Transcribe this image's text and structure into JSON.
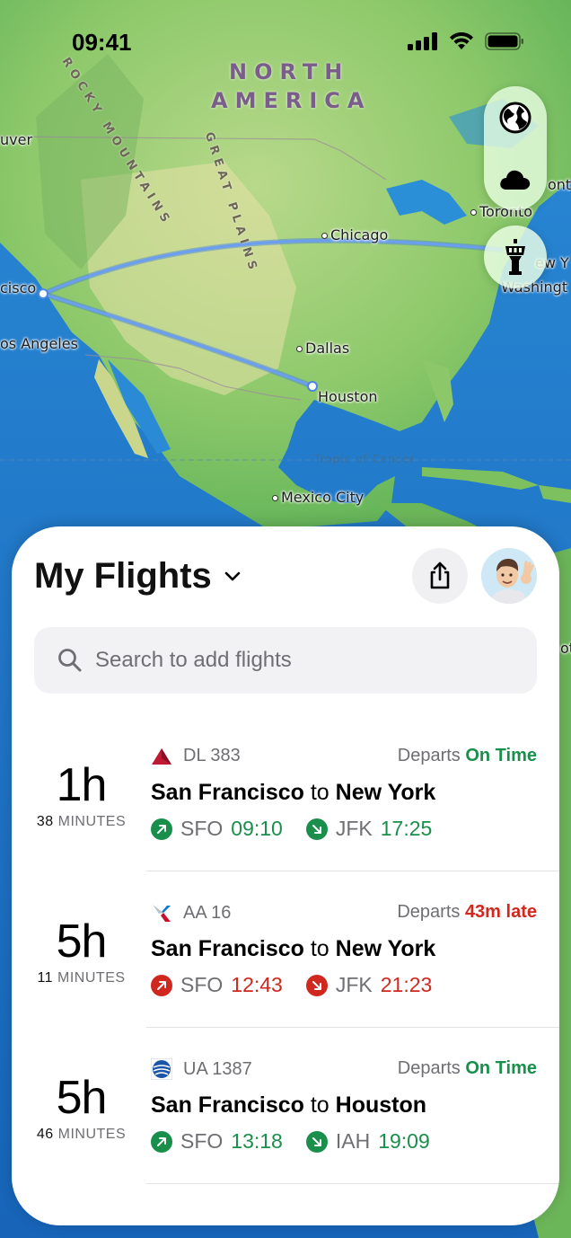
{
  "status_bar": {
    "time": "09:41"
  },
  "map": {
    "region": [
      "NORTH",
      "AMERICA"
    ],
    "mountains": [
      "ROCKY MOUNTAINS",
      "GREAT PLAINS"
    ],
    "tropic": "Tropic of Cancer",
    "cities": {
      "vancouver": "uver",
      "san_francisco": "cisco",
      "los_angeles": "os Angeles",
      "chicago": "Chicago",
      "dallas": "Dallas",
      "houston": "Houston",
      "mexico_city": "Mexico City",
      "toronto": "Toronto",
      "new_york": "ew Y",
      "washington": "Washingt",
      "ont": "ont",
      "ot": "ot"
    }
  },
  "controls": {
    "globe": "globe-icon",
    "cloud": "cloud-icon",
    "tower": "control-tower-icon"
  },
  "sheet": {
    "title": "My Flights",
    "search_placeholder": "Search to add flights"
  },
  "flights": [
    {
      "duration_h": "1h",
      "duration_m": "38",
      "minutes_label": "MINUTES",
      "airline_code": "DL 383",
      "airline_logo": "delta-logo-icon",
      "status_prefix": "Departs",
      "status": "On Time",
      "status_color": "#1a8f4c",
      "from_city": "San Francisco",
      "to_word": "to",
      "to_city": "New York",
      "dep_code": "SFO",
      "dep_time": "09:10",
      "arr_code": "JFK",
      "arr_time": "17:25"
    },
    {
      "duration_h": "5h",
      "duration_m": "11",
      "minutes_label": "MINUTES",
      "airline_code": "AA 16",
      "airline_logo": "american-logo-icon",
      "status_prefix": "Departs",
      "status": "43m late",
      "status_color": "#d0281e",
      "from_city": "San Francisco",
      "to_word": "to",
      "to_city": "New York",
      "dep_code": "SFO",
      "dep_time": "12:43",
      "arr_code": "JFK",
      "arr_time": "21:23"
    },
    {
      "duration_h": "5h",
      "duration_m": "46",
      "minutes_label": "MINUTES",
      "airline_code": "UA 1387",
      "airline_logo": "united-logo-icon",
      "status_prefix": "Departs",
      "status": "On Time",
      "status_color": "#1a8f4c",
      "from_city": "San Francisco",
      "to_word": "to",
      "to_city": "Houston",
      "dep_code": "SFO",
      "dep_time": "13:18",
      "arr_code": "IAH",
      "arr_time": "19:09"
    }
  ]
}
